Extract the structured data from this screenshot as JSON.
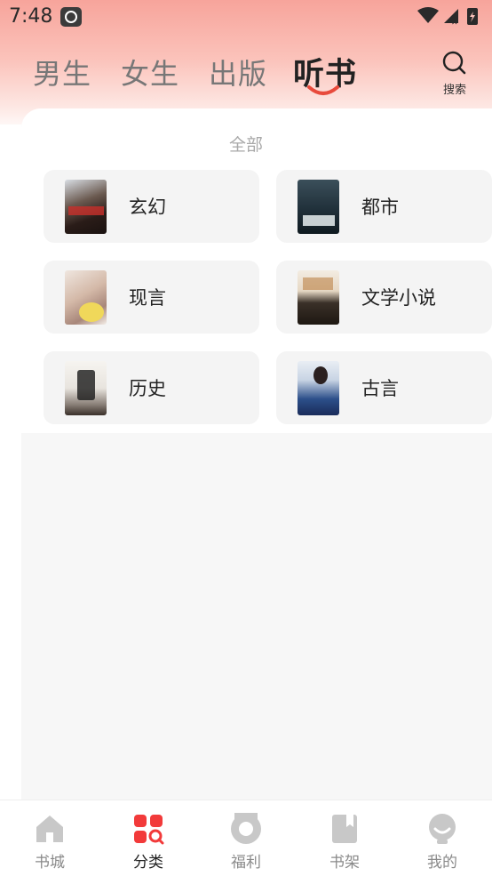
{
  "status_bar": {
    "time": "7:48"
  },
  "top_tabs": [
    {
      "label": "男生"
    },
    {
      "label": "女生"
    },
    {
      "label": "出版"
    },
    {
      "label": "听书"
    }
  ],
  "active_tab": "听书",
  "search": {
    "label": "搜索"
  },
  "section": {
    "title": "全部"
  },
  "categories": [
    {
      "label": "玄幻"
    },
    {
      "label": "都市"
    },
    {
      "label": "现言"
    },
    {
      "label": "文学小说"
    },
    {
      "label": "历史"
    },
    {
      "label": "古言"
    }
  ],
  "bottom_nav": [
    {
      "label": "书城",
      "icon": "home-icon"
    },
    {
      "label": "分类",
      "icon": "category-icon"
    },
    {
      "label": "福利",
      "icon": "gift-icon"
    },
    {
      "label": "书架",
      "icon": "bookshelf-icon"
    },
    {
      "label": "我的",
      "icon": "profile-icon"
    }
  ],
  "active_nav": "分类",
  "colors": {
    "accent": "#f23a3a",
    "tab_underline": "#e84a3c",
    "inactive_icon": "#c8c8c8"
  }
}
